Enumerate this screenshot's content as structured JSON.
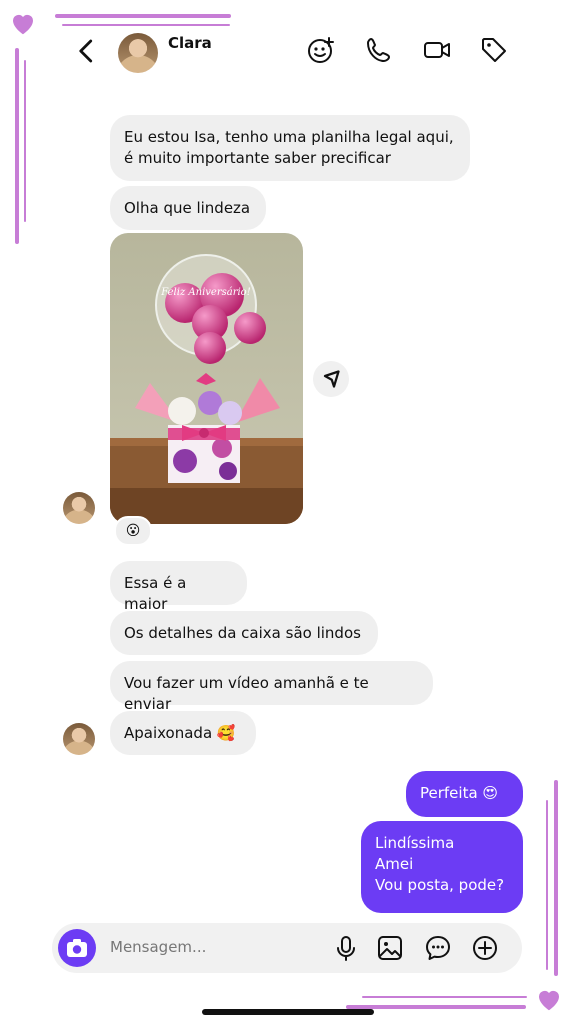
{
  "header": {
    "contact_name": "Clara"
  },
  "messages": {
    "m1_line1": "Eu estou Isa, tenho uma planilha legal aqui,",
    "m1_line2": "é muito importante saber precificar",
    "m2": "Olha que lindeza",
    "photo_text": "Feliz Aniversário!",
    "reaction": "😮",
    "m3": "Essa é a maior",
    "m4": "Os detalhes da caixa são lindos",
    "m5": "Vou fazer um vídeo amanhã e te enviar",
    "m6": "Apaixonada 🥰",
    "o1": "Perfeita 😍",
    "o2_line1": "Lindíssima",
    "o2_line2": "Amei",
    "o2_line3": "Vou posta, pode?"
  },
  "composer": {
    "placeholder": "Mensagem..."
  },
  "colors": {
    "outgoing_bubble": "#6c3cf4",
    "incoming_bubble": "#efefef",
    "decoration": "#c77dd6"
  }
}
